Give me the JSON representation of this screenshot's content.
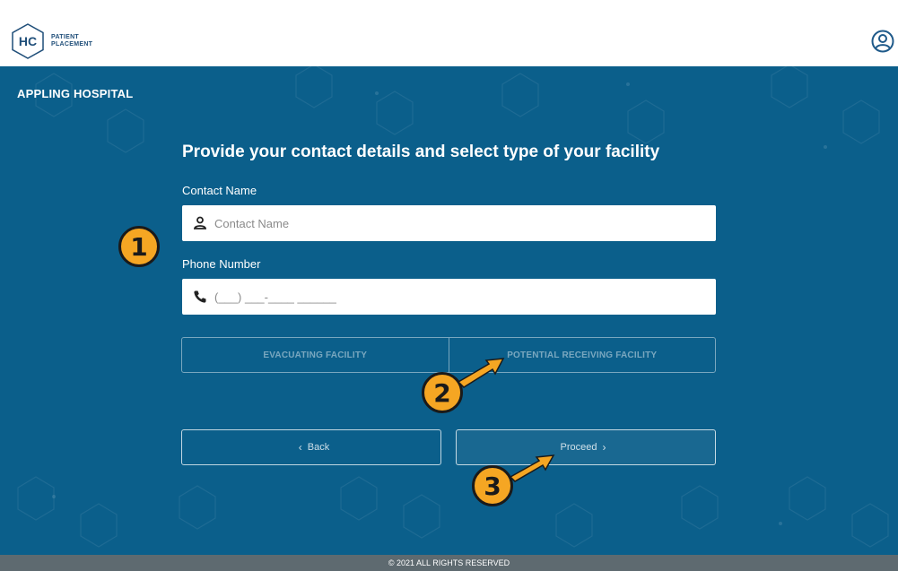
{
  "header": {
    "logo_initials": "HC",
    "logo_line1": "PATIENT",
    "logo_line2": "PLACEMENT",
    "user_icon": "user-circle-icon"
  },
  "page": {
    "hospital_name": "APPLING HOSPITAL",
    "heading": "Provide your contact details and select type of your facility"
  },
  "form": {
    "contact_name_label": "Contact Name",
    "contact_name_placeholder": "Contact Name",
    "contact_name_icon": "user-icon",
    "phone_label": "Phone Number",
    "phone_placeholder": "(___) ___-____ ______",
    "phone_icon": "phone-icon"
  },
  "facility_type": {
    "options": [
      "EVACUATING FACILITY",
      "POTENTIAL RECEIVING FACILITY"
    ]
  },
  "actions": {
    "back_label": "Back",
    "proceed_label": "Proceed"
  },
  "annotations": {
    "badges": [
      "1",
      "2",
      "3"
    ],
    "badge_color": "#f5a623"
  },
  "footer": {
    "copyright": "© 2021 ALL RIGHTS RESERVED"
  },
  "colors": {
    "primary_bg": "#0b5f8b",
    "footer_bg": "#5e6a70",
    "brand": "#1f4e79"
  }
}
